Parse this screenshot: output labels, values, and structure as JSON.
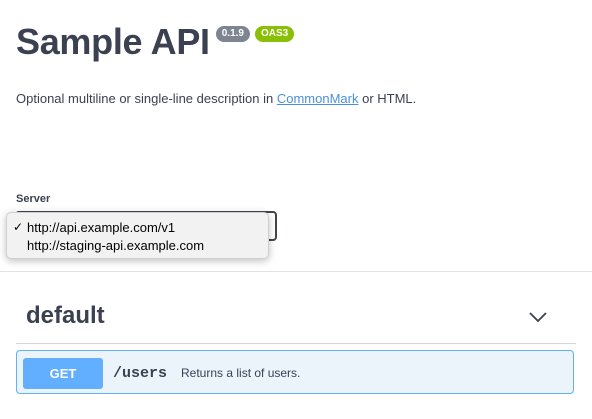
{
  "info": {
    "title": "Sample API",
    "version_badge": "0.1.9",
    "oas_badge": "OAS3",
    "description_prefix": "Optional multiline or single-line description in ",
    "description_link": "CommonMark",
    "description_suffix": " or HTML."
  },
  "servers": {
    "label": "Server",
    "options": [
      {
        "check": "✓",
        "url": "http://api.example.com/v1"
      },
      {
        "check": "",
        "url": "http://staging-api.example.com"
      }
    ],
    "selected_index": 0
  },
  "tags": [
    {
      "name": "default",
      "icon": "chevron-down-icon",
      "operations": [
        {
          "method": "GET",
          "path": "/users",
          "summary": "Returns a list of users."
        }
      ]
    }
  ],
  "colors": {
    "get": "#61affe",
    "get_bg": "#ebf3fb",
    "link": "#4990e2",
    "badge_version": "#7d8492",
    "badge_oas": "#89bf04"
  }
}
